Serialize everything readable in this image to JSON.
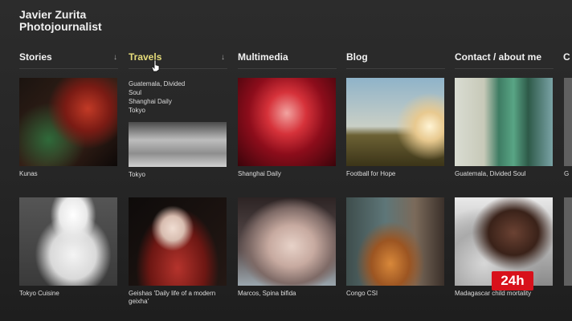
{
  "site": {
    "title_line1": "Javier Zurita",
    "title_line2": "Photojournalist"
  },
  "nav": {
    "items": [
      {
        "label": "Stories"
      },
      {
        "label": "Travels"
      },
      {
        "label": "Multimedia"
      },
      {
        "label": "Blog"
      },
      {
        "label": "Contact / about me"
      },
      {
        "label": "C"
      }
    ],
    "arrow": "↓"
  },
  "dropdown": {
    "items": [
      "Guatemala, Divided",
      "Soul",
      "Shanghai Daily",
      "Tokyo"
    ]
  },
  "gallery": {
    "row1": [
      {
        "caption": "Kunas"
      },
      {
        "caption": "Tokyo"
      },
      {
        "caption": "Shanghai Daily"
      },
      {
        "caption": "Football for Hope"
      },
      {
        "caption": "Guatemala, Divided Soul"
      },
      {
        "caption": "G"
      }
    ],
    "row2": [
      {
        "caption": "Tokyo Cuisine"
      },
      {
        "caption": "Geishas 'Daily life of a modern geixha'"
      },
      {
        "caption": "Marcos, Spina bifida"
      },
      {
        "caption": "Congo CSI"
      },
      {
        "caption": "Madagascar child mortality"
      }
    ]
  },
  "broadcast_logo": "24h"
}
